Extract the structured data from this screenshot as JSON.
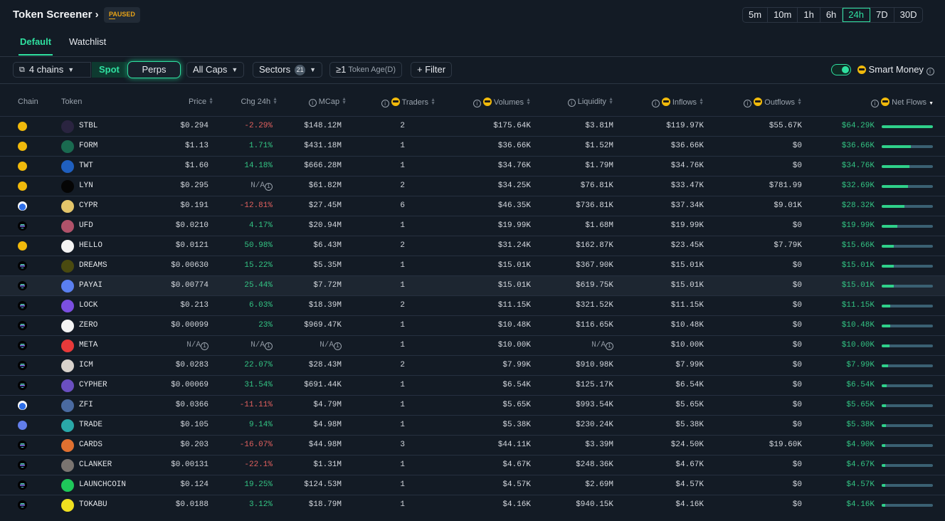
{
  "header": {
    "title": "Token Screener ›",
    "status": "PAUSED"
  },
  "timeframes": [
    {
      "label": "5m"
    },
    {
      "label": "10m"
    },
    {
      "label": "1h"
    },
    {
      "label": "6h"
    },
    {
      "label": "24h",
      "active": true
    },
    {
      "label": "7D"
    },
    {
      "label": "30D"
    }
  ],
  "tabs": [
    "Default",
    "Watchlist"
  ],
  "filters": {
    "chains": "4 chains",
    "spot": "Spot",
    "perps": "Perps",
    "caps": "All Caps",
    "sectors": "Sectors",
    "sectors_count": "21",
    "age_prefix": "≥1",
    "age_label": "Token Age(D)",
    "filter": "+ Filter",
    "smart_money": "Smart Money",
    "smart_money_on": true
  },
  "columns": {
    "chain": "Chain",
    "token": "Token",
    "price": "Price",
    "chg": "Chg 24h",
    "mcap": "MCap",
    "traders": "Traders",
    "volumes": "Volumes",
    "liquidity": "Liquidity",
    "inflows": "Inflows",
    "outflows": "Outflows",
    "netflows": "Net Flows"
  },
  "colors": {
    "accent": "#2fe0a0",
    "positive": "#33c483",
    "negative": "#e0605e",
    "bnb": "#f0b90b",
    "base": "#3b6fe0",
    "solana": "#000000",
    "ethereum": "#627eea"
  },
  "rows": [
    {
      "chain": "bnb",
      "token": "STBL",
      "icon": "#2a2440",
      "price": "$0.294",
      "chg": "-2.29%",
      "mcap": "$148.12M",
      "traders": "2",
      "volumes": "$175.64K",
      "liquidity": "$3.81M",
      "inflows": "$119.97K",
      "outflows": "$55.67K",
      "netflows": "$64.29K",
      "net_fraction": 1.0
    },
    {
      "chain": "bnb",
      "token": "FORM",
      "icon": "#1a6a50",
      "price": "$1.13",
      "chg": "1.71%",
      "mcap": "$431.18M",
      "traders": "1",
      "volumes": "$36.66K",
      "liquidity": "$1.52M",
      "inflows": "$36.66K",
      "outflows": "$0",
      "netflows": "$36.66K",
      "net_fraction": 0.57
    },
    {
      "chain": "bnb",
      "token": "TWT",
      "icon": "#1f5fbf",
      "price": "$1.60",
      "chg": "14.18%",
      "mcap": "$666.28M",
      "traders": "1",
      "volumes": "$34.76K",
      "liquidity": "$1.79M",
      "inflows": "$34.76K",
      "outflows": "$0",
      "netflows": "$34.76K",
      "net_fraction": 0.54
    },
    {
      "chain": "bnb",
      "token": "LYN",
      "icon": "#050505",
      "price": "$0.295",
      "chg": "N/A",
      "mcap": "$61.82M",
      "traders": "2",
      "volumes": "$34.25K",
      "liquidity": "$76.81K",
      "inflows": "$33.47K",
      "outflows": "$781.99",
      "netflows": "$32.69K",
      "net_fraction": 0.51
    },
    {
      "chain": "base",
      "token": "CYPR",
      "icon": "#e3c56a",
      "price": "$0.191",
      "chg": "-12.81%",
      "mcap": "$27.45M",
      "traders": "6",
      "volumes": "$46.35K",
      "liquidity": "$736.81K",
      "inflows": "$37.34K",
      "outflows": "$9.01K",
      "netflows": "$28.32K",
      "net_fraction": 0.44
    },
    {
      "chain": "solana",
      "token": "UFD",
      "icon": "#b0526a",
      "price": "$0.0210",
      "chg": "4.17%",
      "mcap": "$20.94M",
      "traders": "1",
      "volumes": "$19.99K",
      "liquidity": "$1.68M",
      "inflows": "$19.99K",
      "outflows": "$0",
      "netflows": "$19.99K",
      "net_fraction": 0.31
    },
    {
      "chain": "bnb",
      "token": "HELLO",
      "icon": "#f4f4f4",
      "price": "$0.0121",
      "chg": "50.98%",
      "mcap": "$6.43M",
      "traders": "2",
      "volumes": "$31.24K",
      "liquidity": "$162.87K",
      "inflows": "$23.45K",
      "outflows": "$7.79K",
      "netflows": "$15.66K",
      "net_fraction": 0.24
    },
    {
      "chain": "solana",
      "token": "DREAMS",
      "icon": "#4a4a10",
      "price": "$0.00630",
      "chg": "15.22%",
      "mcap": "$5.35M",
      "traders": "1",
      "volumes": "$15.01K",
      "liquidity": "$367.90K",
      "inflows": "$15.01K",
      "outflows": "$0",
      "netflows": "$15.01K",
      "net_fraction": 0.23
    },
    {
      "chain": "solana",
      "token": "PAYAI",
      "icon": "#5a7ff0",
      "price": "$0.00774",
      "chg": "25.44%",
      "mcap": "$7.72M",
      "traders": "1",
      "volumes": "$15.01K",
      "liquidity": "$619.75K",
      "inflows": "$15.01K",
      "outflows": "$0",
      "netflows": "$15.01K",
      "net_fraction": 0.23,
      "highlighted": true
    },
    {
      "chain": "solana",
      "token": "LOCK",
      "icon": "#7b4fe0",
      "price": "$0.213",
      "chg": "6.03%",
      "mcap": "$18.39M",
      "traders": "2",
      "volumes": "$11.15K",
      "liquidity": "$321.52K",
      "inflows": "$11.15K",
      "outflows": "$0",
      "netflows": "$11.15K",
      "net_fraction": 0.17
    },
    {
      "chain": "solana",
      "token": "ZERO",
      "icon": "#f4f4f4",
      "price": "$0.00099",
      "chg": "23%",
      "mcap": "$969.47K",
      "traders": "1",
      "volumes": "$10.48K",
      "liquidity": "$116.65K",
      "inflows": "$10.48K",
      "outflows": "$0",
      "netflows": "$10.48K",
      "net_fraction": 0.16
    },
    {
      "chain": "solana",
      "token": "META",
      "icon": "#e83a3a",
      "price": "N/A",
      "chg": "N/A",
      "mcap": "N/A",
      "traders": "1",
      "volumes": "$10.00K",
      "liquidity": "N/A",
      "inflows": "$10.00K",
      "outflows": "$0",
      "netflows": "$10.00K",
      "net_fraction": 0.155
    },
    {
      "chain": "solana",
      "token": "ICM",
      "icon": "#d8d2cc",
      "price": "$0.0283",
      "chg": "22.07%",
      "mcap": "$28.43M",
      "traders": "2",
      "volumes": "$7.99K",
      "liquidity": "$910.98K",
      "inflows": "$7.99K",
      "outflows": "$0",
      "netflows": "$7.99K",
      "net_fraction": 0.12
    },
    {
      "chain": "solana",
      "token": "CYPHER",
      "icon": "#6a4fc0",
      "price": "$0.00069",
      "chg": "31.54%",
      "mcap": "$691.44K",
      "traders": "1",
      "volumes": "$6.54K",
      "liquidity": "$125.17K",
      "inflows": "$6.54K",
      "outflows": "$0",
      "netflows": "$6.54K",
      "net_fraction": 0.1
    },
    {
      "chain": "base",
      "token": "ZFI",
      "icon": "#4a6aa0",
      "price": "$0.0366",
      "chg": "-11.11%",
      "mcap": "$4.79M",
      "traders": "1",
      "volumes": "$5.65K",
      "liquidity": "$993.54K",
      "inflows": "$5.65K",
      "outflows": "$0",
      "netflows": "$5.65K",
      "net_fraction": 0.088
    },
    {
      "chain": "ethereum",
      "token": "TRADE",
      "icon": "#2aa8a8",
      "price": "$0.105",
      "chg": "9.14%",
      "mcap": "$4.98M",
      "traders": "1",
      "volumes": "$5.38K",
      "liquidity": "$230.24K",
      "inflows": "$5.38K",
      "outflows": "$0",
      "netflows": "$5.38K",
      "net_fraction": 0.084
    },
    {
      "chain": "solana",
      "token": "CARDS",
      "icon": "#e07030",
      "price": "$0.203",
      "chg": "-16.07%",
      "mcap": "$44.98M",
      "traders": "3",
      "volumes": "$44.11K",
      "liquidity": "$3.39M",
      "inflows": "$24.50K",
      "outflows": "$19.60K",
      "netflows": "$4.90K",
      "net_fraction": 0.076
    },
    {
      "chain": "solana",
      "token": "CLANKER",
      "icon": "#7a7470",
      "price": "$0.00131",
      "chg": "-22.1%",
      "mcap": "$1.31M",
      "traders": "1",
      "volumes": "$4.67K",
      "liquidity": "$248.36K",
      "inflows": "$4.67K",
      "outflows": "$0",
      "netflows": "$4.67K",
      "net_fraction": 0.073
    },
    {
      "chain": "solana",
      "token": "LAUNCHCOIN",
      "icon": "#1fc85a",
      "price": "$0.124",
      "chg": "19.25%",
      "mcap": "$124.53M",
      "traders": "1",
      "volumes": "$4.57K",
      "liquidity": "$2.69M",
      "inflows": "$4.57K",
      "outflows": "$0",
      "netflows": "$4.57K",
      "net_fraction": 0.071
    },
    {
      "chain": "solana",
      "token": "TOKABU",
      "icon": "#f0e020",
      "price": "$0.0188",
      "chg": "3.12%",
      "mcap": "$18.79M",
      "traders": "1",
      "volumes": "$4.16K",
      "liquidity": "$940.15K",
      "inflows": "$4.16K",
      "outflows": "$0",
      "netflows": "$4.16K",
      "net_fraction": 0.065
    }
  ]
}
